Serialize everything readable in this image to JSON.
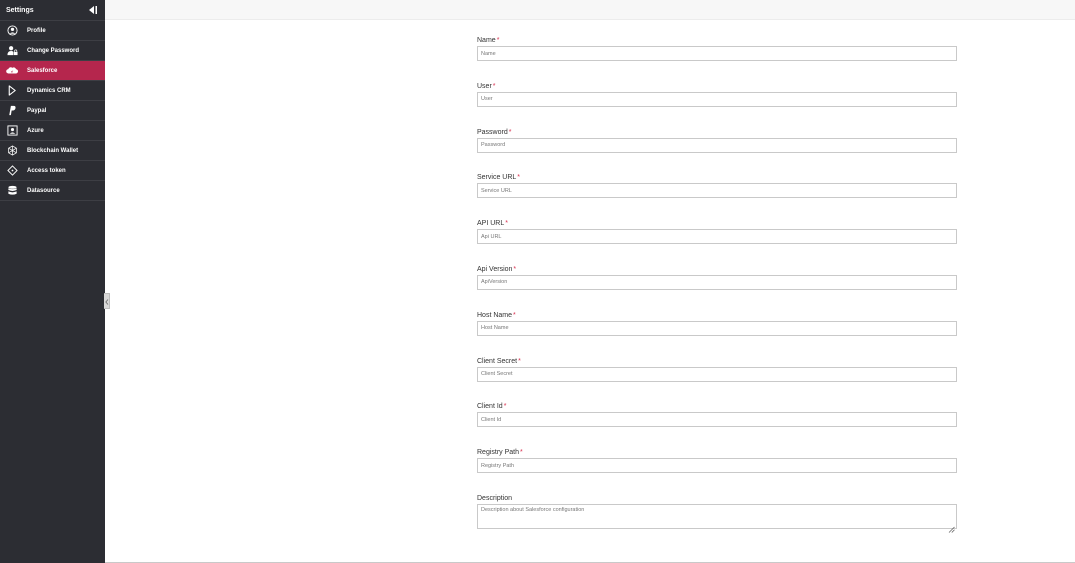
{
  "sidebar": {
    "title": "Settings",
    "items": [
      {
        "label": "Profile",
        "icon": "user-circle-icon"
      },
      {
        "label": "Change Password",
        "icon": "user-lock-icon"
      },
      {
        "label": "Salesforce",
        "icon": "salesforce-cloud-icon",
        "active": true
      },
      {
        "label": "Dynamics CRM",
        "icon": "dynamics-icon"
      },
      {
        "label": "Paypal",
        "icon": "paypal-icon"
      },
      {
        "label": "Azure",
        "icon": "azure-icon"
      },
      {
        "label": "Blockchain Wallet",
        "icon": "blockchain-icon"
      },
      {
        "label": "Access token",
        "icon": "token-icon"
      },
      {
        "label": "Datasource",
        "icon": "database-icon"
      }
    ]
  },
  "form": {
    "required_marker": "*",
    "fields": [
      {
        "label": "Name",
        "placeholder": "Name"
      },
      {
        "label": "User",
        "placeholder": "User"
      },
      {
        "label": "Password",
        "placeholder": "Password"
      },
      {
        "label": "Service URL",
        "placeholder": "Service URL"
      },
      {
        "label": "API URL",
        "placeholder": "Api URL"
      },
      {
        "label": "Api Version",
        "placeholder": "ApiVersion"
      },
      {
        "label": "Host Name",
        "placeholder": "Host Name"
      },
      {
        "label": "Client Secret",
        "placeholder": "Client Secret"
      },
      {
        "label": "Client Id",
        "placeholder": "Client Id"
      },
      {
        "label": "Registry Path",
        "placeholder": "Registry Path"
      }
    ],
    "description": {
      "label": "Description",
      "placeholder": "Description about Salesforce configuration"
    }
  },
  "colors": {
    "sidebar_bg": "#2c2d33",
    "accent": "#b5264d",
    "required": "#d9304f"
  }
}
